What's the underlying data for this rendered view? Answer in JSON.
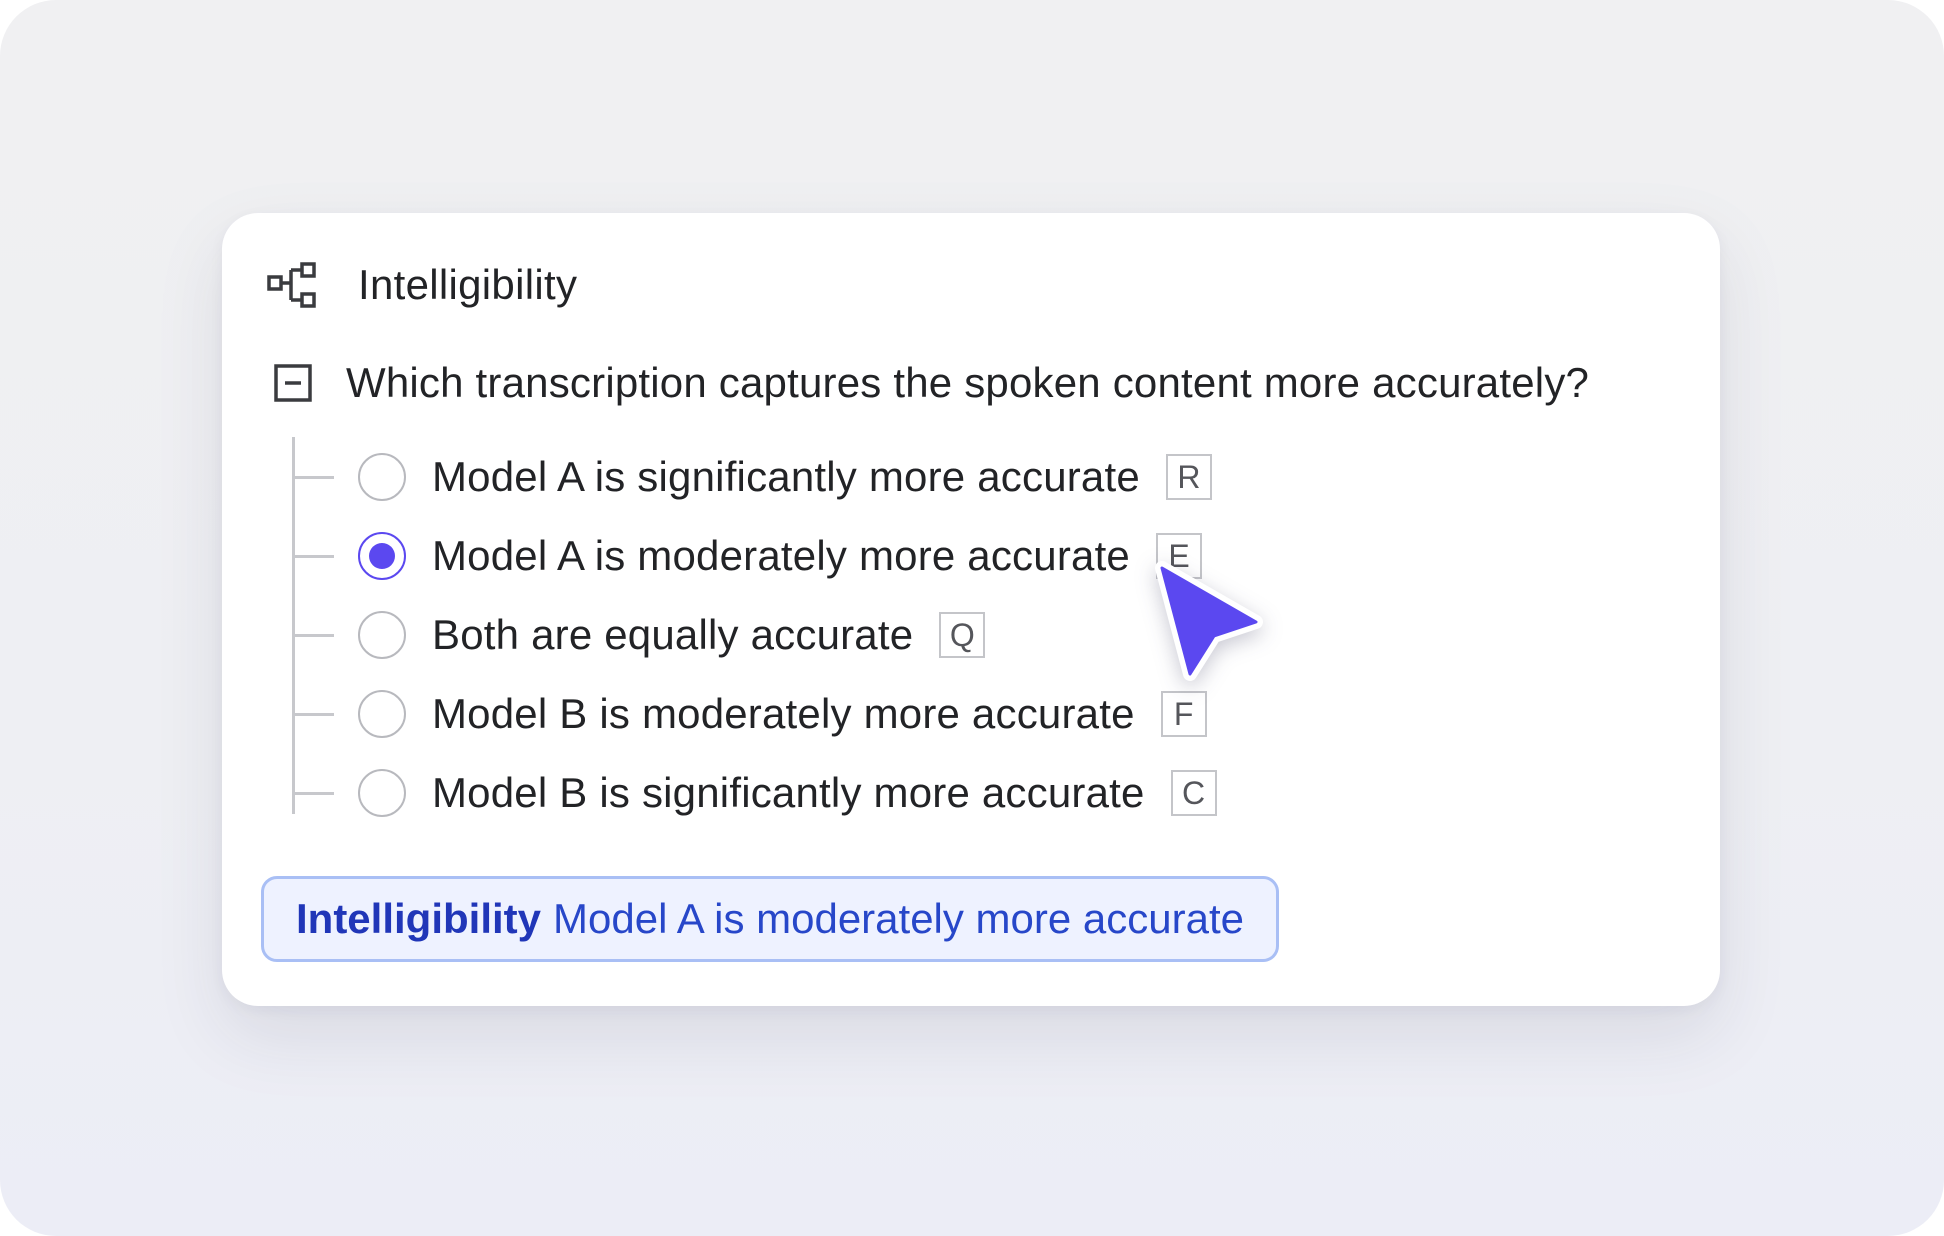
{
  "header": {
    "icon": "hierarchy-icon",
    "title": "Intelligibility"
  },
  "question": {
    "icon": "collapse-icon",
    "text": "Which transcription captures the spoken content more accurately?"
  },
  "options": [
    {
      "label": "Model A is significantly more accurate",
      "hotkey": "R",
      "selected": false
    },
    {
      "label": "Model A is moderately more accurate",
      "hotkey": "E",
      "selected": true
    },
    {
      "label": "Both are equally accurate",
      "hotkey": "Q",
      "selected": false
    },
    {
      "label": "Model B is moderately more accurate",
      "hotkey": "F",
      "selected": false
    },
    {
      "label": "Model B is significantly more accurate",
      "hotkey": "C",
      "selected": false
    }
  ],
  "summary": {
    "title": "Intelligibility",
    "value": "Model A is moderately more accurate"
  },
  "colors": {
    "accent": "#5b48f0",
    "summary_text": "#2747c9",
    "summary_bg": "#eef2ff",
    "summary_border": "#a9bff5"
  }
}
